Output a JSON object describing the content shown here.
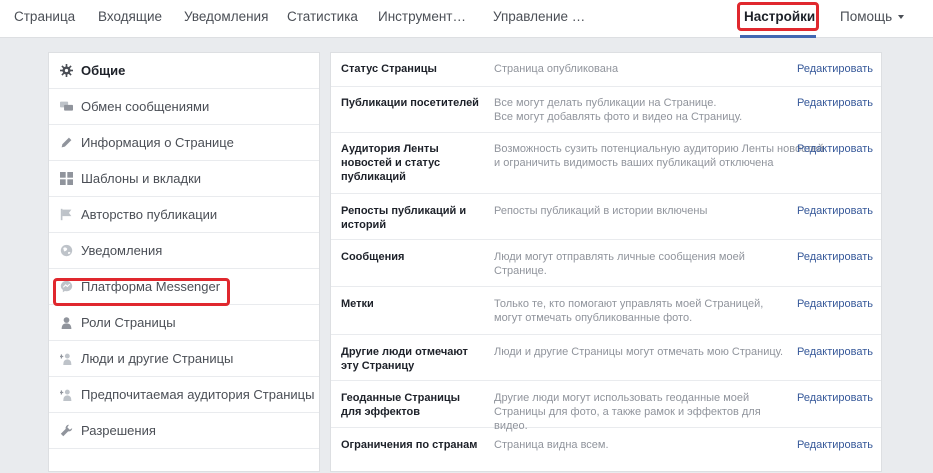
{
  "topnav": {
    "tabs": [
      "Страница",
      "Входящие",
      "Уведомления",
      "Статистика",
      "Инструмент…",
      "Управление …",
      "Настройки",
      "Помощь"
    ]
  },
  "sidebar": {
    "items": [
      {
        "label": "Общие",
        "icon": "gear-icon"
      },
      {
        "label": "Обмен сообщениями",
        "icon": "chat-bubbles-icon"
      },
      {
        "label": "Информация о Странице",
        "icon": "pencil-icon"
      },
      {
        "label": "Шаблоны и вкладки",
        "icon": "grid-icon"
      },
      {
        "label": "Авторство публикации",
        "icon": "flag-icon"
      },
      {
        "label": "Уведомления",
        "icon": "globe-icon"
      },
      {
        "label": "Платформа Messenger",
        "icon": "messenger-icon"
      },
      {
        "label": "Роли Страницы",
        "icon": "person-icon"
      },
      {
        "label": "Люди и другие Страницы",
        "icon": "person-plus-icon"
      },
      {
        "label": "Предпочитаемая аудитория Страницы",
        "icon": "person-plus-icon"
      },
      {
        "label": "Разрешения",
        "icon": "wrench-icon"
      }
    ]
  },
  "settings": {
    "edit_label": "Редактировать",
    "rows": [
      {
        "name": "Статус Страницы",
        "value": "Страница опубликована"
      },
      {
        "name": "Публикации посетителей",
        "value": "Все могут делать публикации на Странице.\nВсе могут добавлять фото и видео на Страницу."
      },
      {
        "name": "Аудитория Ленты новостей и статус публикаций",
        "value": "Возможность сузить потенциальную аудиторию Ленты новостей и ограничить видимость ваших публикаций отключена"
      },
      {
        "name": "Репосты публикаций и историй",
        "value": "Репосты публикаций в истории включены"
      },
      {
        "name": "Сообщения",
        "value": "Люди могут отправлять личные сообщения моей Странице."
      },
      {
        "name": "Метки",
        "value": "Только те, кто помогают управлять моей Страницей, могут отмечать опубликованные фото."
      },
      {
        "name": "Другие люди отмечают эту Страницу",
        "value": "Люди и другие Страницы могут отмечать мою Страницу."
      },
      {
        "name": "Геоданные Страницы для эффектов",
        "value": "Другие люди могут использовать геоданные моей Страницы для фото, а также рамок и эффектов для видео."
      },
      {
        "name": "Ограничения по странам",
        "value": "Страница видна всем."
      }
    ]
  }
}
